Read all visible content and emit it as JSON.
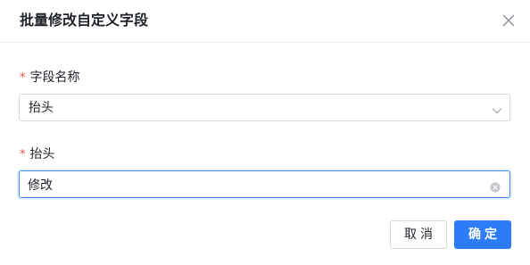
{
  "dialog": {
    "title": "批量修改自定义字段",
    "close_icon": "close-icon"
  },
  "form": {
    "field_name": {
      "required_mark": "*",
      "label": "字段名称",
      "selected_value": "抬头",
      "icon": "chevron-down-icon"
    },
    "header_field": {
      "required_mark": "*",
      "label": "抬头",
      "value": "修改",
      "icon": "clear-icon"
    }
  },
  "footer": {
    "cancel_label": "取消",
    "ok_label": "确定"
  },
  "colors": {
    "primary": "#2b7cf6",
    "required": "#f54a45",
    "focus_border": "#3c8cf0"
  }
}
